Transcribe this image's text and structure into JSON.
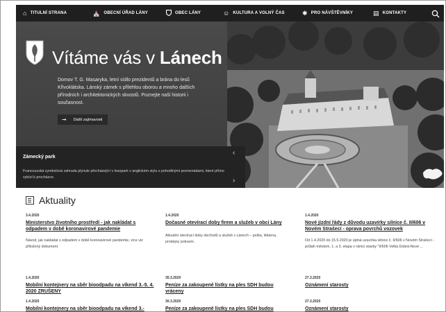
{
  "nav": {
    "items": [
      {
        "label": "TITULNÍ STRANA",
        "icon": "home-icon"
      },
      {
        "label": "OBECNÍ ÚŘAD LÁNY",
        "icon": "town-hall-icon"
      },
      {
        "label": "OBEC LÁNY",
        "icon": "shield-icon"
      },
      {
        "label": "KULTURA A VOLNÝ ČAS",
        "icon": "masks-icon"
      },
      {
        "label": "PRO NÁVŠTĚVNÍKY",
        "icon": "tourist-icon"
      },
      {
        "label": "KONTAKTY",
        "icon": "contact-card-icon"
      }
    ],
    "search_icon": "search-icon"
  },
  "hero": {
    "title_pre": "Vítáme vás v ",
    "title_bold": "Lánech",
    "text": "Domov T. G. Masaryka, letní sídlo prezidentů a brána do lesů Křivoklátska. Lánský zámek s přilehlou oborou a mnoho dalších přírodních i architektonických skvostů. Poznejte naši historii i současnost.",
    "button": "Další zajímavosti",
    "slide_title": "Zámecký park",
    "slide_desc": "Francouzská symbolová zahrada plynule přecházející v lesopark v anglickém stylu s pohodlnými promenádami, které přímo vybízí k procházce."
  },
  "aktuality": {
    "title": "Aktuality",
    "items": [
      {
        "date": "3.4.2020",
        "title": "Ministerstvo životního prostředí - jak nakládat s odpadem v době koronavirové pandemie",
        "desc": "Návod, jak nakládat s odpadem v době koronavirové pandemie, více viz přiložený dokument."
      },
      {
        "date": "1.4.2020",
        "title": "Dočasné otevírací doby firem a služeb v obci Lány",
        "desc": "Aktuální otevírací doby obchodů a služeb v Lánech – pošta, lékárna, prodejny potravin."
      },
      {
        "date": "1.4.2020",
        "title": "Nové jízdní řády z důvodu uzavírky silnice č. II/606 v Novém Strašecí - oprava povrchů vozovek",
        "desc": "Od 1.4.2020 do 15.5.2020 je úplná uzavírka silnice č. II/606 v Novém Strašecí - průtah městem, 1. a 3. etapa v rámci stavby \"II/606 Velká Dobrá-Nové ..."
      },
      {
        "date": "1.4.2020",
        "title": "Mobilní kontejnery na sběr bioodpadu na víkend 3.-5. 4. 2020 ZRUŠENY",
        "desc": ""
      },
      {
        "date": "30.3.2020",
        "title": "Peníze za zakoupené lístky na ples SDH budou vráceny",
        "desc": ""
      },
      {
        "date": "27.3.2020",
        "title": "Oznámení starosty",
        "desc": ""
      },
      {
        "date": "1.4.2020",
        "title": "Mobilní kontejnery na sběr bioodpadu na víkend 3.-",
        "desc": ""
      },
      {
        "date": "30.3.2020",
        "title": "Peníze za zakoupené lístky na ples SDH budou",
        "desc": ""
      },
      {
        "date": "27.3.2020",
        "title": "Oznámení starosty",
        "desc": ""
      }
    ]
  }
}
